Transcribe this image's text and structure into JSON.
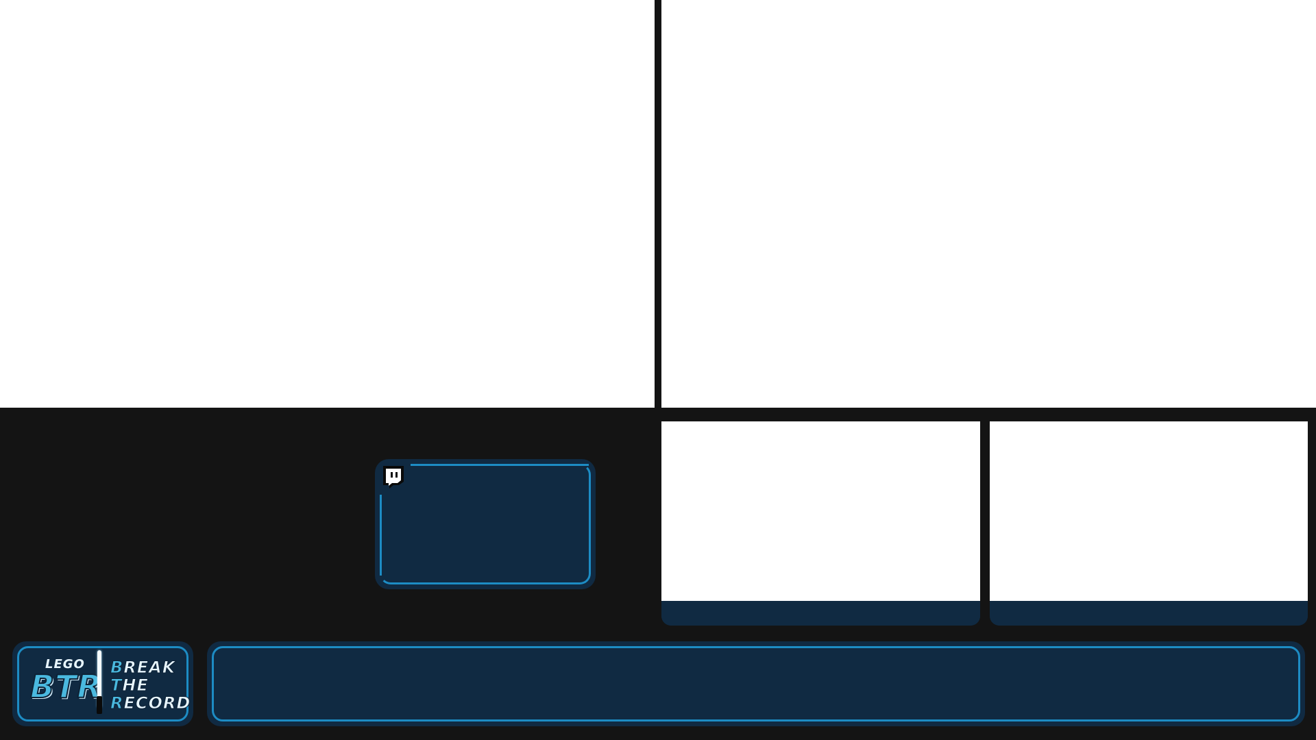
{
  "overlay": {
    "logo": {
      "small_text": "LEGO",
      "acronym": "BTR",
      "words": [
        {
          "cap": "B",
          "rest": "REAK"
        },
        {
          "cap": "T",
          "rest": "HE"
        },
        {
          "cap": "R",
          "rest": "ECORD"
        }
      ],
      "icon": "lightsaber-icon"
    },
    "chat": {
      "icon": "twitch-icon"
    },
    "colors": {
      "background": "#141414",
      "panel": "#102a42",
      "accent": "#1d8cc4",
      "logo_blue": "#4ab9df",
      "slot": "#ffffff"
    }
  }
}
